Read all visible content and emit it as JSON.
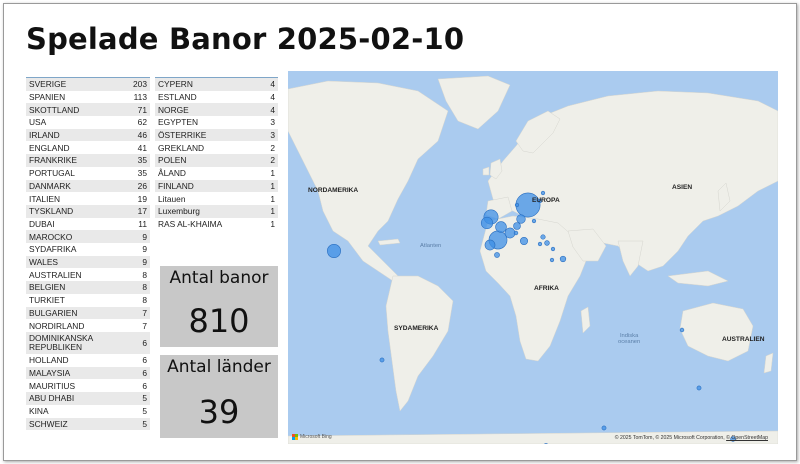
{
  "title": "Spelade Banor 2025-02-10",
  "table_left": [
    {
      "name": "SVERIGE",
      "value": "203"
    },
    {
      "name": "SPANIEN",
      "value": "113"
    },
    {
      "name": "SKOTTLAND",
      "value": "71"
    },
    {
      "name": "USA",
      "value": "62"
    },
    {
      "name": "IRLAND",
      "value": "46"
    },
    {
      "name": "ENGLAND",
      "value": "41"
    },
    {
      "name": "FRANKRIKE",
      "value": "35"
    },
    {
      "name": "PORTUGAL",
      "value": "35"
    },
    {
      "name": "DANMARK",
      "value": "26"
    },
    {
      "name": "ITALIEN",
      "value": "19"
    },
    {
      "name": "TYSKLAND",
      "value": "17"
    },
    {
      "name": "DUBAI",
      "value": "11"
    },
    {
      "name": "MAROCKO",
      "value": "9"
    },
    {
      "name": "SYDAFRIKA",
      "value": "9"
    },
    {
      "name": "WALES",
      "value": "9"
    },
    {
      "name": "AUSTRALIEN",
      "value": "8"
    },
    {
      "name": "BELGIEN",
      "value": "8"
    },
    {
      "name": "TURKIET",
      "value": "8"
    },
    {
      "name": "BULGARIEN",
      "value": "7"
    },
    {
      "name": "NORDIRLAND",
      "value": "7"
    },
    {
      "name": "DOMINIKANSKA REPUBLIKEN",
      "value": "6"
    },
    {
      "name": "HOLLAND",
      "value": "6"
    },
    {
      "name": "MALAYSIA",
      "value": "6"
    },
    {
      "name": "MAURITIUS",
      "value": "6"
    },
    {
      "name": "ABU DHABI",
      "value": "5"
    },
    {
      "name": "KINA",
      "value": "5"
    },
    {
      "name": "SCHWEIZ",
      "value": "5"
    }
  ],
  "table_right": [
    {
      "name": "CYPERN",
      "value": "4"
    },
    {
      "name": "ESTLAND",
      "value": "4"
    },
    {
      "name": "NORGE",
      "value": "4"
    },
    {
      "name": "EGYPTEN",
      "value": "3"
    },
    {
      "name": "ÖSTERRIKE",
      "value": "3"
    },
    {
      "name": "GREKLAND",
      "value": "2"
    },
    {
      "name": "POLEN",
      "value": "2"
    },
    {
      "name": "ÅLAND",
      "value": "1"
    },
    {
      "name": "FINLAND",
      "value": "1"
    },
    {
      "name": "Litauen",
      "value": "1"
    },
    {
      "name": "Luxemburg",
      "value": "1"
    },
    {
      "name": "RAS AL-KHAIMA",
      "value": "1"
    }
  ],
  "cards": {
    "banor": {
      "label": "Antal banor",
      "value": "810"
    },
    "lander": {
      "label": "Antal länder",
      "value": "39"
    }
  },
  "map": {
    "regions": {
      "north_america": "NORDAMERIKA",
      "europe": "EUROPA",
      "asia": "ASIEN",
      "africa": "AFRIKA",
      "south_america": "SYDAMERIKA",
      "australia": "AUSTRALIEN"
    },
    "oceans": {
      "atlantic": "Atlanten",
      "indian_line1": "Indiska",
      "indian_line2": "oceanen"
    },
    "attribution_text": "© 2025 TomTom, © 2025 Microsoft Corporation, ",
    "attribution_link": "© OpenStreetMap",
    "logo_text": "Microsoft Bing",
    "colors": {
      "water": "#aacbef",
      "land": "#efefe9",
      "bubble": "#3d8fe6"
    }
  }
}
